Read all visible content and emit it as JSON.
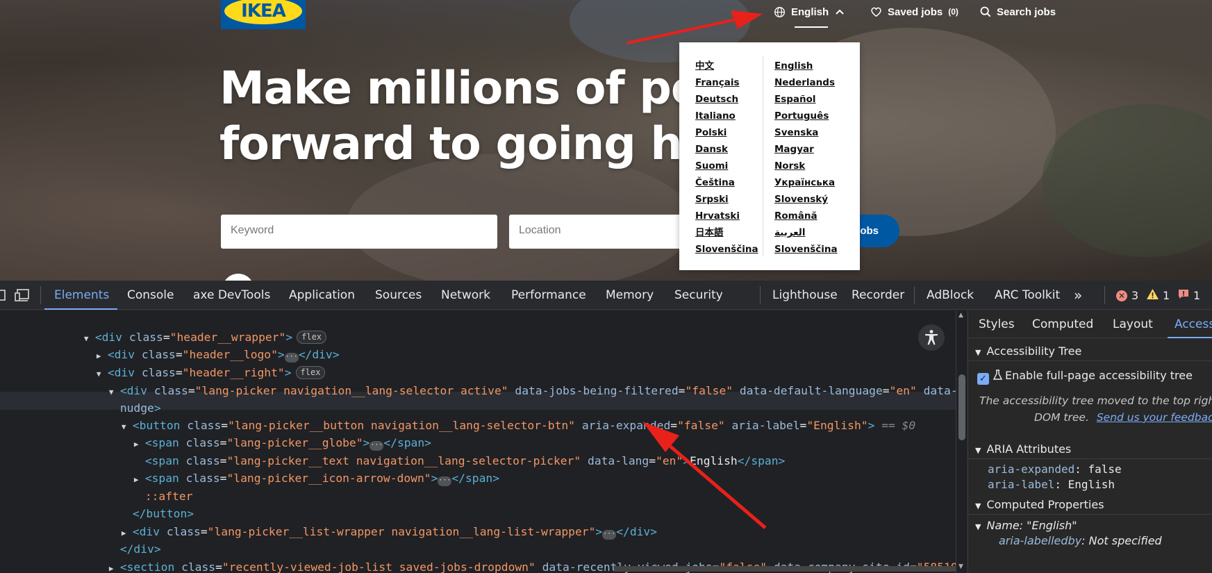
{
  "site": {
    "logo_text": "IKEA",
    "nav": {
      "language_label": "English",
      "saved_jobs_label": "Saved jobs",
      "saved_jobs_count": "(0)",
      "search_jobs_label": "Search jobs"
    },
    "hero": {
      "line1": "Make millions of peo",
      "line2": "forward to going hor"
    },
    "search": {
      "keyword_placeholder": "Keyword",
      "location_placeholder": "Location",
      "button_label": "jobs"
    },
    "languages_col1": [
      "中文",
      "Français",
      "Deutsch",
      "Italiano",
      "Polski",
      "Dansk",
      "Suomi",
      "Čeština",
      "Srpski",
      "Hrvatski",
      "日本語",
      "Slovenščina"
    ],
    "languages_col2": [
      "English",
      "Nederlands",
      "Español",
      "Português",
      "Svenska",
      "Magyar",
      "Norsk",
      "Українська",
      "Slovenský",
      "Română",
      "العربية",
      "Slovenščina"
    ]
  },
  "devtools": {
    "tabs": [
      "Elements",
      "Console",
      "axe DevTools",
      "Application",
      "Sources",
      "Network",
      "Performance",
      "Memory",
      "Security",
      "Lighthouse",
      "Recorder",
      "AdBlock",
      "ARC Toolkit"
    ],
    "more_tabs": "»",
    "errors": "3",
    "warnings": "1",
    "issues": "1",
    "flex_badge": "flex",
    "code": {
      "l1_open": "<div ",
      "l1_attr": "class",
      "l1_val": "\"header__wrapper\"",
      "l2_val": "\"header__logo\"",
      "l3_val": "\"header__right\"",
      "l4_val": "\"lang-picker navigation__lang-selector active\"",
      "l4_attr2": "data-jobs-being-filtered",
      "l4_val2": "\"false\"",
      "l4_attr3": "data-default-language",
      "l4_val3": "\"en\"",
      "l4_attr4": "data-",
      "l4_cont": "nudge",
      "l5_val": "\"lang-picker__button navigation__lang-selector-btn\"",
      "l5_attr2": "aria-expanded",
      "l5_val2": "\"false\"",
      "l5_attr3": "aria-label",
      "l5_val3": "\"English\"",
      "l5_eq": "== $0",
      "l6_val": "\"lang-picker__globe\"",
      "l7_val": "\"lang-picker__text navigation__lang-selector-picker\"",
      "l7_attr2": "data-lang",
      "l7_val2": "\"en\"",
      "l7_text": "English",
      "l8_val": "\"lang-picker__icon-arrow-down\"",
      "l9_pseudo": "::after",
      "l11_val": "\"lang-picker__list-wrapper navigation__lang-list-wrapper\"",
      "l13_val": "\"recently-viewed-job-list saved-jobs-dropdown\"",
      "l13_attr2": "data-recently-viewed-jobs",
      "l13_val2": "\"false\"",
      "l13_attr3": "data-company-site-id",
      "l13_val3": "\"58510\""
    },
    "side": {
      "tabs": [
        "Styles",
        "Computed",
        "Layout",
        "Accessi"
      ],
      "a11y_tree_head": "Accessibility Tree",
      "enable_label": "Enable full-page accessibility tree",
      "moved_line1": "The accessibility tree moved to the top right",
      "moved_line2": "DOM tree.",
      "feedback_link": "Send us your feedbac",
      "aria_head": "ARIA Attributes",
      "aria_expanded_key": "aria-expanded",
      "aria_expanded_val": "false",
      "aria_label_key": "aria-label",
      "aria_label_val": "English",
      "computed_head": "Computed Properties",
      "name_label": "Name: \"English\"",
      "labelledby_key": "aria-labelledby",
      "labelledby_val": "Not specified"
    }
  },
  "colors": {
    "ikea_blue": "#0058a3",
    "ikea_yellow": "#ffda1a",
    "annotation_red": "#e8211a",
    "devtools_accent": "#7cacf8"
  }
}
